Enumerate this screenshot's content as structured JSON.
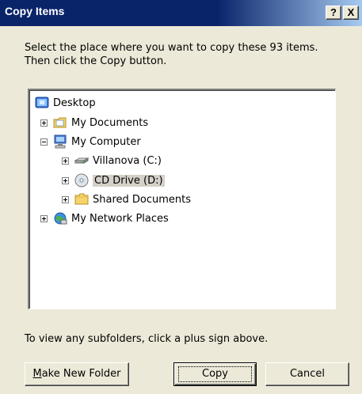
{
  "window": {
    "title": "Copy Items",
    "help_label": "?",
    "close_label": "X"
  },
  "prompt": {
    "line1": "Select the place where you want to copy these 93 items.",
    "line2": "Then click the Copy button."
  },
  "tree": {
    "nodes": [
      {
        "label": "Desktop",
        "icon": "desktop-icon",
        "expander": "none"
      },
      {
        "label": "My Documents",
        "icon": "my-documents-icon",
        "expander": "plus"
      },
      {
        "label": "My Computer",
        "icon": "my-computer-icon",
        "expander": "minus"
      },
      {
        "label": "Villanova (C:)",
        "icon": "hard-drive-icon",
        "expander": "plus"
      },
      {
        "label": "CD Drive (D:)",
        "icon": "cd-drive-icon",
        "expander": "plus",
        "selected": true
      },
      {
        "label": "Shared Documents",
        "icon": "folder-icon",
        "expander": "plus"
      },
      {
        "label": "My Network Places",
        "icon": "network-places-icon",
        "expander": "plus"
      }
    ]
  },
  "hint": "To view any subfolders, click a plus sign above.",
  "buttons": {
    "make_new_folder_first": "M",
    "make_new_folder_rest": "ake New Folder",
    "copy": "Copy",
    "cancel": "Cancel"
  },
  "colors": {
    "titlebar": "#0a246a",
    "face": "#ece9d8",
    "selection": "#d4d0c8"
  }
}
